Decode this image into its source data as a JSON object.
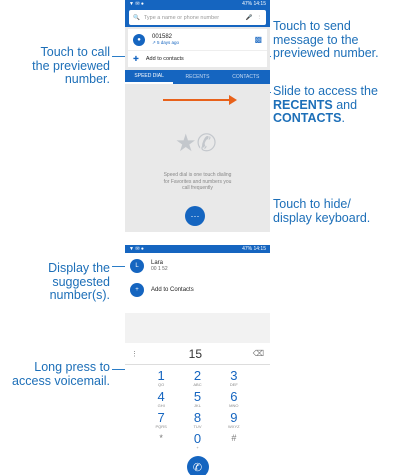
{
  "callouts": {
    "call_previewed": [
      "Touch to call",
      "the previewed",
      "number."
    ],
    "send_message": [
      "Touch to send",
      "message to the",
      "previewed number."
    ],
    "slide_access": [
      "Slide to access the",
      "and",
      "."
    ],
    "slide_bold_1": "RECENTS",
    "slide_bold_2": "CONTACTS",
    "hide_keyboard": [
      "Touch to hide/",
      "display keyboard."
    ],
    "display_suggested": [
      "Display the",
      "suggested",
      "number(s)."
    ],
    "long_press": [
      "Long press to",
      "access voicemail."
    ]
  },
  "screen1": {
    "status_time": "14:15",
    "status_battery": "47%",
    "search_placeholder": "Type a name or phone number",
    "contact_number": "001582",
    "contact_time": "5 days ago",
    "add_to_contacts": "Add to contacts",
    "tabs": [
      "SPEED DIAL",
      "RECENTS",
      "CONTACTS"
    ],
    "speed_dial_text": [
      "Speed dial is one touch dialing",
      "for Favorites and numbers you",
      "call frequently"
    ]
  },
  "screen2": {
    "status_time": "14:15",
    "status_battery": "47%",
    "suggest_name": "Lara",
    "suggest_number": "00 1 52",
    "add_to_contacts": "Add to Contacts",
    "dial_input": "15",
    "keys": [
      {
        "n": "1",
        "l": "QO"
      },
      {
        "n": "2",
        "l": "ABC"
      },
      {
        "n": "3",
        "l": "DEF"
      },
      {
        "n": "4",
        "l": "GHI"
      },
      {
        "n": "5",
        "l": "JKL"
      },
      {
        "n": "6",
        "l": "MNO"
      },
      {
        "n": "7",
        "l": "PQRS"
      },
      {
        "n": "8",
        "l": "TUV"
      },
      {
        "n": "9",
        "l": "WXYZ"
      },
      {
        "n": "*",
        "l": ""
      },
      {
        "n": "0",
        "l": "+"
      },
      {
        "n": "#",
        "l": ""
      }
    ]
  },
  "colors": {
    "accent": "#1565c0",
    "callout": "#1d6fb8"
  }
}
